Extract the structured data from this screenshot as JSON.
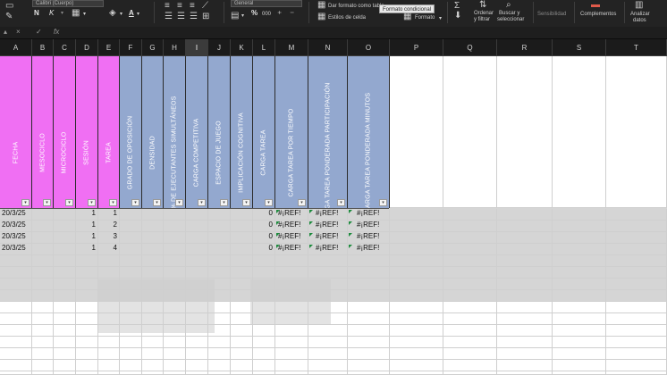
{
  "ribbon": {
    "font_name": "Calibri (Cuerpo)",
    "bold": "N",
    "italic": "K",
    "subscript_sign": "S",
    "number_format": "General",
    "percent": "%",
    "thousands": "000",
    "cond_format_label": "Dar formato como tabla",
    "cell_styles_label": "Estilos de celda",
    "tooltip": "Formato condicional",
    "format_label": "Formato",
    "sort_label_1": "Ordenar",
    "sort_label_2": "y filtrar",
    "find_label_1": "Buscar y",
    "find_label_2": "seleccionar",
    "sensitivity_label": "Sensibilidad",
    "addins_label": "Complementos",
    "analyze_label_1": "Analizar",
    "analyze_label_2": "datos"
  },
  "formula_bar": {
    "cell_ref": "I1",
    "cancel": "×",
    "enter": "✓",
    "fx": "fx",
    "value": ""
  },
  "columns": [
    "A",
    "B",
    "C",
    "D",
    "E",
    "F",
    "G",
    "H",
    "I",
    "J",
    "K",
    "L",
    "M",
    "N",
    "O",
    "P",
    "Q",
    "R",
    "S",
    "T"
  ],
  "selected_column": "I",
  "headers": [
    {
      "col": "A",
      "text": "FECHA",
      "color": "pink"
    },
    {
      "col": "B",
      "text": "MESOCICLO",
      "color": "pink"
    },
    {
      "col": "C",
      "text": "MICROCICLO",
      "color": "pink"
    },
    {
      "col": "D",
      "text": "SESIÓN",
      "color": "pink"
    },
    {
      "col": "E",
      "text": "TAREA",
      "color": "pink"
    },
    {
      "col": "F",
      "text": "GRADO DE OPOSICIÓN",
      "color": "blue"
    },
    {
      "col": "G",
      "text": "DENSIDAD",
      "color": "blue"
    },
    {
      "col": "H",
      "text": "% DE EJECUTANTES SIMULTÁNEOS",
      "color": "blue"
    },
    {
      "col": "I",
      "text": "CARGA COMPETITIVA",
      "color": "blue"
    },
    {
      "col": "J",
      "text": "ESPACIO DE JUEGO",
      "color": "blue"
    },
    {
      "col": "K",
      "text": "IMPLICACIÓN COGNITIVA",
      "color": "blue"
    },
    {
      "col": "L",
      "text": "CARGA TAREA",
      "color": "blue"
    },
    {
      "col": "M",
      "text": "CARGA TAREA POR TIEMPO",
      "color": "blue"
    },
    {
      "col": "N",
      "text": "CARGA TAREA PONDERADA PARTICIPACIÓN",
      "color": "blue"
    },
    {
      "col": "O",
      "text": "CARGA TAREA PONDERADA MINUTOS",
      "color": "blue"
    }
  ],
  "rows": [
    {
      "fecha": "20/3/25",
      "sesion": "1",
      "tarea": "1",
      "carga_tarea": "0",
      "m": "#¡REF!",
      "n": "#¡REF!",
      "o": "#¡REF!"
    },
    {
      "fecha": "20/3/25",
      "sesion": "1",
      "tarea": "2",
      "carga_tarea": "0",
      "m": "#¡REF!",
      "n": "#¡REF!",
      "o": "#¡REF!"
    },
    {
      "fecha": "20/3/25",
      "sesion": "1",
      "tarea": "3",
      "carga_tarea": "0",
      "m": "#¡REF!",
      "n": "#¡REF!",
      "o": "#¡REF!"
    },
    {
      "fecha": "20/3/25",
      "sesion": "1",
      "tarea": "4",
      "carga_tarea": "0",
      "m": "#¡REF!",
      "n": "#¡REF!",
      "o": "#¡REF!"
    }
  ],
  "colors": {
    "header_pink": "#f06ff3",
    "header_blue": "#93a8cf",
    "error_marker": "#1c8a3c"
  }
}
